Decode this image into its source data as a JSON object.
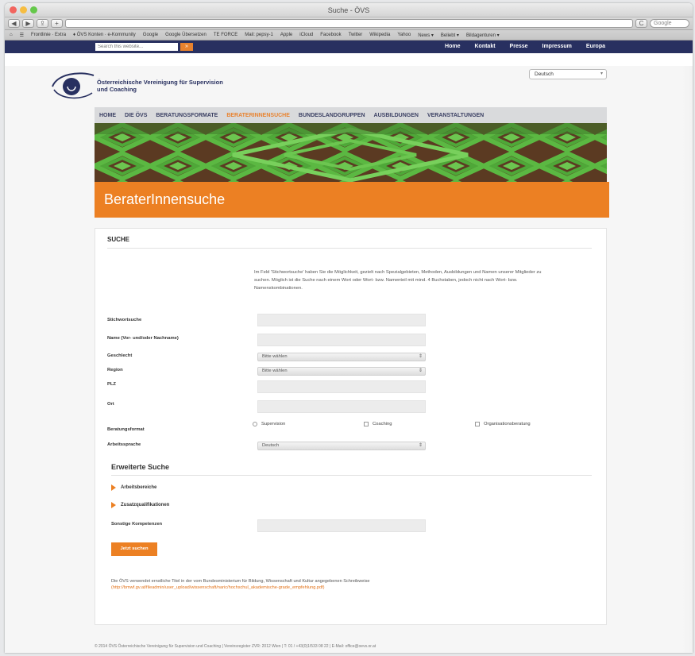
{
  "window": {
    "title": "Suche - ÖVS",
    "url": "",
    "nav_back": "◀",
    "nav_forward": "▶",
    "share": "⇪",
    "add": "+",
    "reload": "C",
    "google_placeholder": "Google"
  },
  "bookmarks": [
    "⌂",
    "☰",
    "Frontlinie · Extra",
    "♦ ÖVS Konten · e-Kommunity",
    "Google",
    "Google Übersetzen",
    "TE FORCE",
    "Mail: pepsy-1",
    "Apple",
    "iCloud",
    "Facebook",
    "Twitter",
    "Wikipedia",
    "Yahoo",
    "News ▾",
    "Beliebt ▾",
    "Bildagenturen ▾"
  ],
  "topnav": {
    "search_placeholder": "Search this website...",
    "search_button": "»",
    "links": [
      "Home",
      "Kontakt",
      "Presse",
      "Impressum",
      "Europa"
    ]
  },
  "header": {
    "org_name": "Österreichische Vereinigung für Supervision und Coaching",
    "language": "Deutsch"
  },
  "mainnav": [
    "HOME",
    "DIE ÖVS",
    "BERATUNGSFORMATE",
    "BERATERINNENSUCHE",
    "BUNDESLANDGRUPPEN",
    "AUSBILDUNGEN",
    "VERANSTALTUNGEN"
  ],
  "mainnav_active": 3,
  "page": {
    "title": "BeraterInnensuche"
  },
  "form": {
    "heading": "SUCHE",
    "intro": "Im Feld 'Stichwortsuche' haben Sie die Möglichkeit, gezielt nach Spezialgebieten, Methoden, Ausbildungen und Namen unserer Mitglieder zu suchen. Möglich ist die Suche nach einem Wort oder Wort- bzw. Namenteil mit mind. 4 Buchstaben, jedoch nicht nach Wort- bzw. Namenskombinationen.",
    "label_stichwort": "Stichwortsuche",
    "label_name": "Name (Vor- und/oder Nachname)",
    "label_geschlecht": "Geschlecht",
    "label_region": "Region",
    "label_plz": "PLZ",
    "label_ort": "Ort",
    "label_beratungsformat": "Beratungsformat",
    "label_arbeitssprache": "Arbeitssprache",
    "select_geschlecht": "Bitte wählen",
    "select_region": "Bitte wählen",
    "select_sprache": "Deutsch",
    "cb_supervision": "Supervision",
    "cb_coaching": "Coaching",
    "cb_organisation": "Organisationsberatung",
    "advanced_title": "Erweiterte Suche",
    "exp_arbeitsbereiche": "Arbeitsbereiche",
    "exp_zusatz": "Zusatzqualifikationen",
    "label_sonstige": "Sonstige Kompetenzen",
    "submit": "Jetzt suchen",
    "note": "Die ÖVS verwendet ernstliche Titel in der vom Bundesministerium für Bildung, Wissenschaft und Kultur angegebenen Schreibweise",
    "note_link": "(http://bmwf.gv.at/fileadmin/user_upload/wissenschaft/naric/hochschul_akademische-grade_empfehlung.pdf)"
  },
  "footer": "© 2014 ÖVS Österreichische Vereinigung für Supervision und Coaching | Vereinsregister ZVR: 2012 Wien | T: 01 / +43(0)1/533 08 22 | E-Mail: office@oevs.or.at",
  "colors": {
    "brand_navy": "#283060",
    "accent_orange": "#ec8023"
  }
}
